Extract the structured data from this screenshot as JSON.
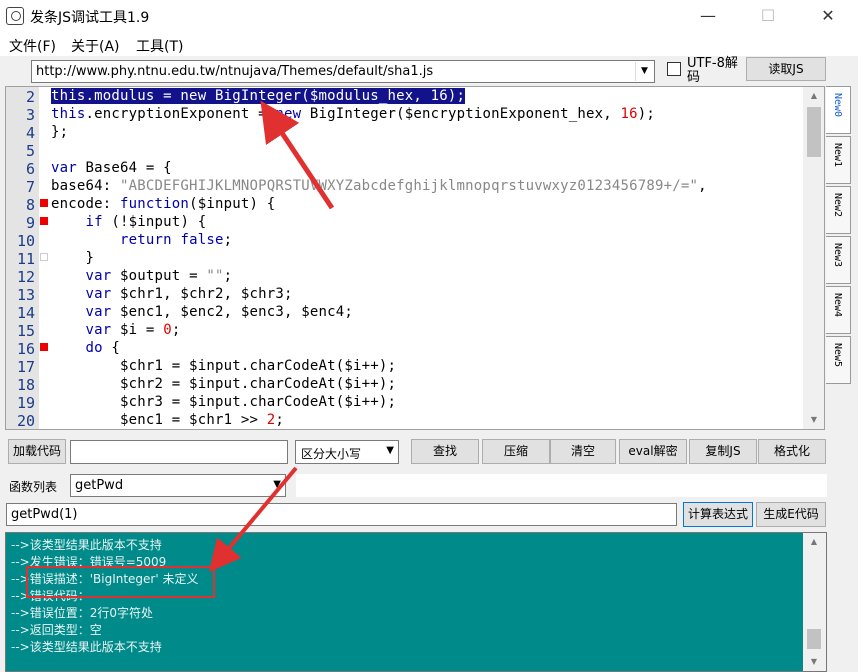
{
  "window": {
    "title": "发条JS调试工具1.9",
    "min_glyph": "—",
    "max_glyph": "☐",
    "close_glyph": "✕"
  },
  "menu": [
    "文件(F)",
    "关于(A)",
    "工具(T)"
  ],
  "url_bar": {
    "value": "http://www.phy.ntnu.edu.tw/ntnujava/Themes/default/sha1.js",
    "checkbox_label": "UTF-8解码",
    "checkbox_checked": false,
    "read_button": "读取JS"
  },
  "editor": {
    "line_numbers": [
      "2",
      "3",
      "4",
      "5",
      "6",
      "7",
      "8",
      "9",
      "10",
      "11",
      "12",
      "13",
      "14",
      "15",
      "16",
      "17",
      "18",
      "19",
      "20"
    ],
    "fold_markers": {
      "6": "box",
      "8": "red",
      "9": "red",
      "16": "red"
    },
    "lines": [
      "this.modulus = new BigInteger($modulus_hex, 16);",
      "this.encryptionExponent = new BigInteger($encryptionExponent_hex, 16);",
      "};",
      "",
      "var Base64 = {",
      "base64: \"ABCDEFGHIJKLMNOPQRSTUVWXYZabcdefghijklmnopqrstuvwxyz0123456789+/=\",",
      "encode: function($input) {",
      "    if (!$input) {",
      "        return false;",
      "    }",
      "    var $output = \"\";",
      "    var $chr1, $chr2, $chr3;",
      "    var $enc1, $enc2, $enc3, $enc4;",
      "    var $i = 0;",
      "    do {",
      "        $chr1 = $input.charCodeAt($i++);",
      "        $chr2 = $input.charCodeAt($i++);",
      "        $chr3 = $input.charCodeAt($i++);",
      "        $enc1 = $chr1 >> 2;"
    ],
    "selected_line_index": 0
  },
  "tabs": [
    "New0",
    "New1",
    "New2",
    "New3",
    "New4",
    "New5"
  ],
  "active_tab": 0,
  "toolbar": {
    "load_code": "加载代码",
    "load_input": "",
    "case_select": "区分大小写",
    "find": "查找",
    "compress": "压缩",
    "clear": "清空",
    "eval_decode": "eval解密",
    "copy_js": "复制JS",
    "format": "格式化"
  },
  "functions": {
    "label": "函数列表",
    "selected": "getPwd"
  },
  "expression": {
    "value": "getPwd(1)",
    "compute_button": "计算表达式",
    "gen_e_button": "生成E代码"
  },
  "output": {
    "lines": [
      "-->该类型结果此版本不支持",
      "-->发生错误：错误号=5009",
      "-->错误描述：'BigInteger' 未定义",
      "-->错误代码：",
      "-->错误位置：2行0字符处",
      "-->返回类型：空",
      "-->该类型结果此版本不支持"
    ]
  },
  "colors": {
    "selection": "#12128a",
    "keyword": "#0000aa",
    "number": "#e00000",
    "output_bg": "#008a8a",
    "annotation": "#e03030"
  }
}
